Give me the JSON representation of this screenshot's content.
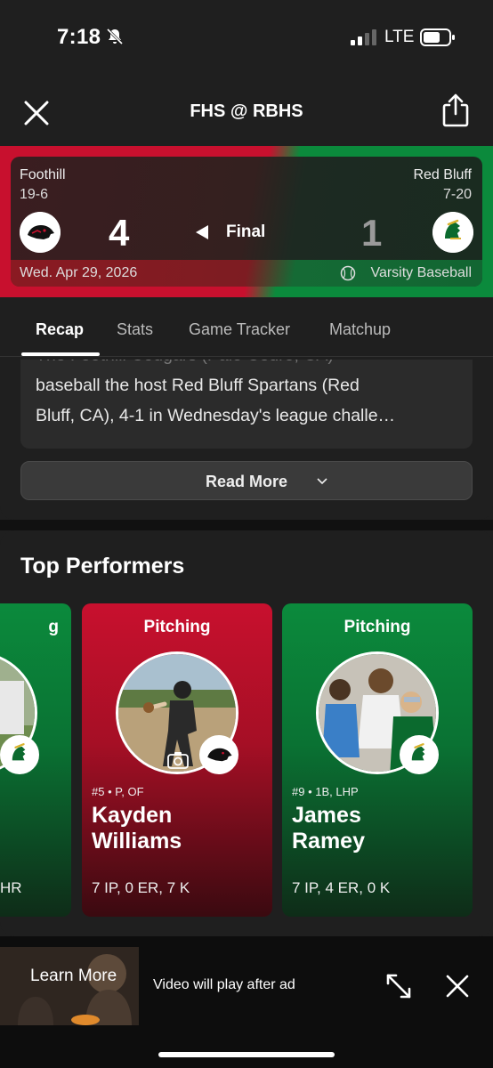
{
  "status": {
    "time": "7:18",
    "network": "LTE"
  },
  "header": {
    "title": "FHS @ RBHS"
  },
  "game": {
    "home": {
      "name": "Foothill",
      "record": "19-6",
      "score": "4"
    },
    "away": {
      "name": "Red Bluff",
      "record": "7-20",
      "score": "1"
    },
    "status": "Final",
    "date": "Wed. Apr 29, 2026",
    "sport": "Varsity Baseball",
    "colors": {
      "home": "#c8102e",
      "away": "#0b8a3c"
    }
  },
  "tabs": [
    "Recap",
    "Stats",
    "Game Tracker",
    "Matchup"
  ],
  "recap": {
    "line1": "The Foothill Cougars (Palo Cedro, CA)",
    "line2": "baseball the host Red Bluff Spartans (Red",
    "line3": "Bluff, CA), 4-1 in Wednesday's league challe…",
    "read_more": "Read More"
  },
  "performers": {
    "title": "Top Performers",
    "partial_card": {
      "category": "g",
      "stat": "HR"
    },
    "cards": [
      {
        "category": "Pitching",
        "meta": "#5 • P, OF",
        "name_first": "Kayden",
        "name_last": "Williams",
        "stat": "7 IP, 0 ER, 7 K"
      },
      {
        "category": "Pitching",
        "meta": "#9 • 1B, LHP",
        "name_first": "James",
        "name_last": "Ramey",
        "stat": "7 IP, 4 ER, 0 K"
      }
    ]
  },
  "ad": {
    "learn_more": "Learn More",
    "message": "Video will play after ad",
    "progress": 0.42
  }
}
